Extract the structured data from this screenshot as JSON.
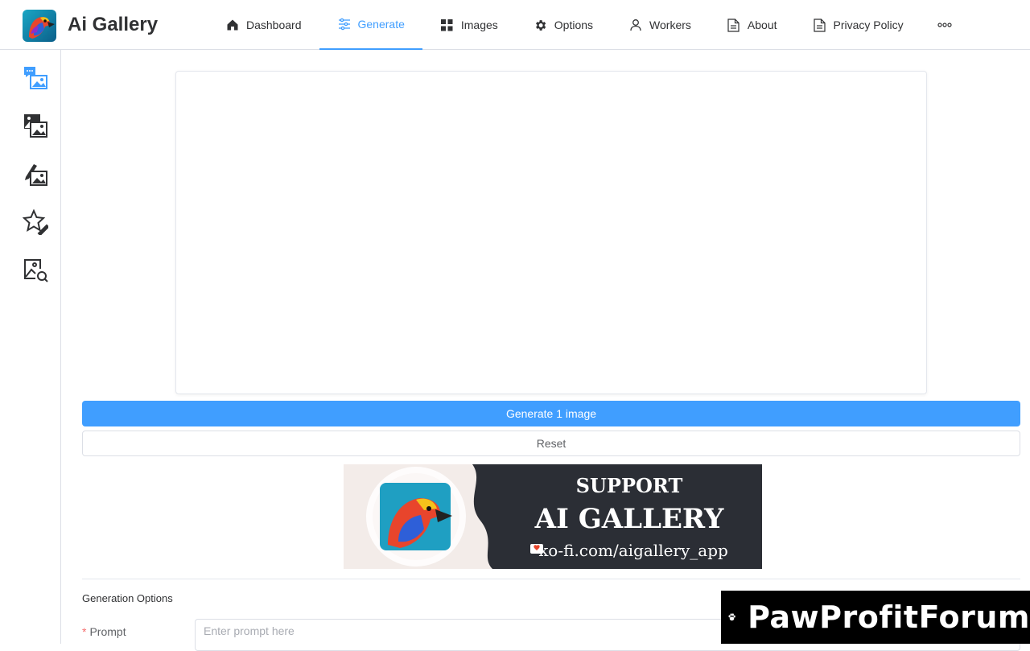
{
  "app": {
    "title": "Ai Gallery",
    "accent_color": "#409eff",
    "logo_icon": "parrot-logo"
  },
  "nav": {
    "items": [
      {
        "label": "Dashboard",
        "icon": "home-icon",
        "active": false
      },
      {
        "label": "Generate",
        "icon": "sliders-icon",
        "active": true
      },
      {
        "label": "Images",
        "icon": "grid-icon",
        "active": false
      },
      {
        "label": "Options",
        "icon": "gear-icon",
        "active": false
      },
      {
        "label": "Workers",
        "icon": "user-icon",
        "active": false
      },
      {
        "label": "About",
        "icon": "document-icon",
        "active": false
      },
      {
        "label": "Privacy Policy",
        "icon": "document-icon",
        "active": false
      }
    ],
    "more_icon": "more-dots-icon"
  },
  "sidebar": {
    "items": [
      {
        "icon": "chat-image-icon",
        "active": true
      },
      {
        "icon": "images-stack-icon",
        "active": false
      },
      {
        "icon": "edit-image-icon",
        "active": false
      },
      {
        "icon": "star-edit-icon",
        "active": false
      },
      {
        "icon": "image-search-icon",
        "active": false
      }
    ]
  },
  "actions": {
    "generate_label": "Generate 1 image",
    "reset_label": "Reset"
  },
  "banner": {
    "line1": "SUPPORT",
    "line2": "AI GALLERY",
    "url": "ko-fi.com/aigallery_app"
  },
  "form": {
    "section_title": "Generation Options",
    "prompt_label": "Prompt",
    "prompt_required": "*",
    "prompt_placeholder": "Enter prompt here",
    "prompt_value": ""
  },
  "watermark": {
    "text": "PawProfitForum"
  }
}
